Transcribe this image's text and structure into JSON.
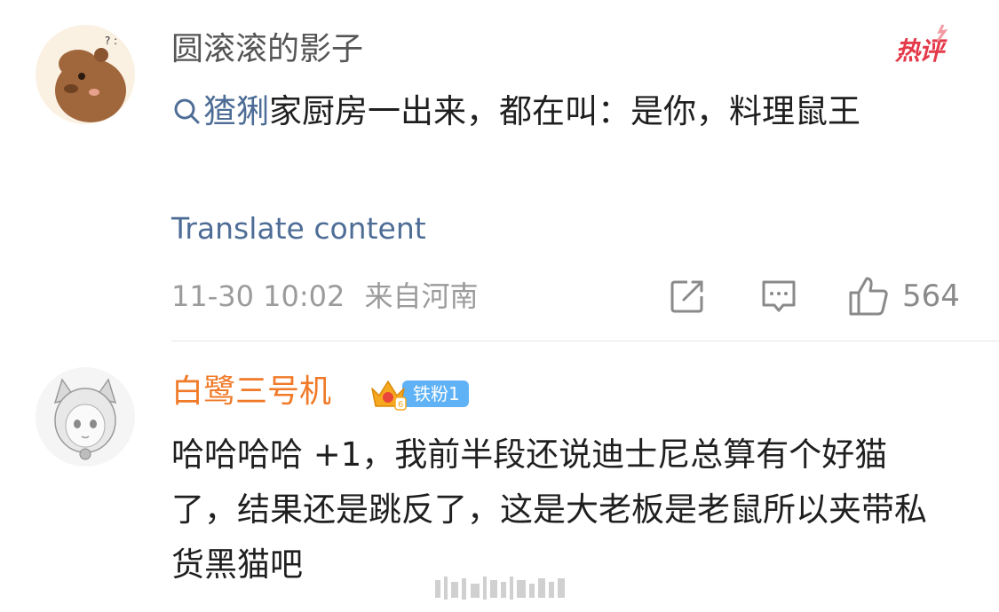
{
  "comments": [
    {
      "username": "圆滚滚的影子",
      "badge": "热评",
      "search_term": "猹猁",
      "text": "家厨房一出来，都在叫：是你，料理鼠王",
      "translate": "Translate content",
      "time": "11-30 10:02",
      "location": "来自河南",
      "likes": "564"
    },
    {
      "username": "白鹭三号机",
      "fan_badge": "铁粉1",
      "text": "哈哈哈哈 +1，我前半段还说迪士尼总算有个好猫了，结果还是跳反了，这是大老板是老鼠所以夹带私货黑猫吧"
    }
  ],
  "colors": {
    "link": "#4e6d96",
    "hot": "#e43a4a",
    "username_vip": "#f07a28",
    "fan_badge": "#5fb2f5"
  },
  "icons": [
    "search-icon",
    "repost-icon",
    "comment-icon",
    "like-icon",
    "crown-icon"
  ]
}
